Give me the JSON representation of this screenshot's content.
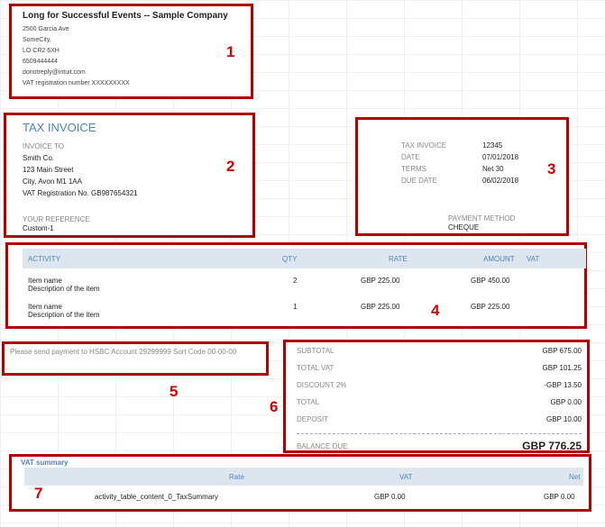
{
  "company": {
    "name": "Long for Successful Events -- Sample Company",
    "address_lines": [
      "2500 Garcia Ave",
      "SomeCity,",
      "LO CR2 6XH",
      "6509444444",
      "donotreply@intuit.com",
      "VAT registration number XXXXXXXXX"
    ]
  },
  "invoice_to": {
    "heading": "TAX INVOICE",
    "label": "INVOICE TO",
    "lines": [
      "Smith Co.",
      "123 Main Street",
      "City, Avon M1 1AA",
      "VAT Registration No. GB987654321"
    ],
    "ref_label": "YOUR REFERENCE",
    "ref_value": "Custom-1"
  },
  "invoice_meta": {
    "rows": [
      {
        "label": "TAX INVOICE",
        "value": "12345"
      },
      {
        "label": "DATE",
        "value": "07/01/2018"
      },
      {
        "label": "TERMS",
        "value": "Net 30"
      },
      {
        "label": "DUE DATE",
        "value": "06/02/2018"
      }
    ],
    "payment_label": "PAYMENT METHOD",
    "payment_value": "CHEQUE"
  },
  "activity": {
    "headers": {
      "activity": "ACTIVITY",
      "qty": "QTY",
      "rate": "RATE",
      "amount": "AMOUNT",
      "vat": "VAT"
    },
    "rows": [
      {
        "name": "Item name",
        "desc": "Description of the item",
        "qty": "2",
        "rate": "GBP 225.00",
        "amount": "GBP 450.00"
      },
      {
        "name": "Item name",
        "desc": "Description of the item",
        "qty": "1",
        "rate": "GBP 225.00",
        "amount": "GBP 225.00"
      }
    ]
  },
  "payment_note": "Please send payment to HSBC Account 29299999 Sort Code 00-00-00",
  "totals": {
    "rows": [
      {
        "label": "SUBTOTAL",
        "value": "GBP 675.00"
      },
      {
        "label": "TOTAL VAT",
        "value": "GBP 101.25"
      },
      {
        "label": "DISCOUNT 2%",
        "value": "-GBP 13.50"
      },
      {
        "label": "TOTAL",
        "value": "GBP 0.00"
      },
      {
        "label": "DEPOSIT",
        "value": "GBP 10.00"
      }
    ],
    "balance_label": "BALANCE DUE",
    "balance_value": "GBP 776.25"
  },
  "vat_summary": {
    "title": "VAT summary",
    "headers": {
      "rate": "Rate",
      "vat": "VAT",
      "net": "Net"
    },
    "row": {
      "rate": "activity_table_content_0_TaxSummary",
      "vat": "GBP 0.00",
      "net": "GBP 0.00"
    }
  },
  "section_numbers": [
    "1",
    "2",
    "3",
    "4",
    "5",
    "6",
    "7"
  ]
}
